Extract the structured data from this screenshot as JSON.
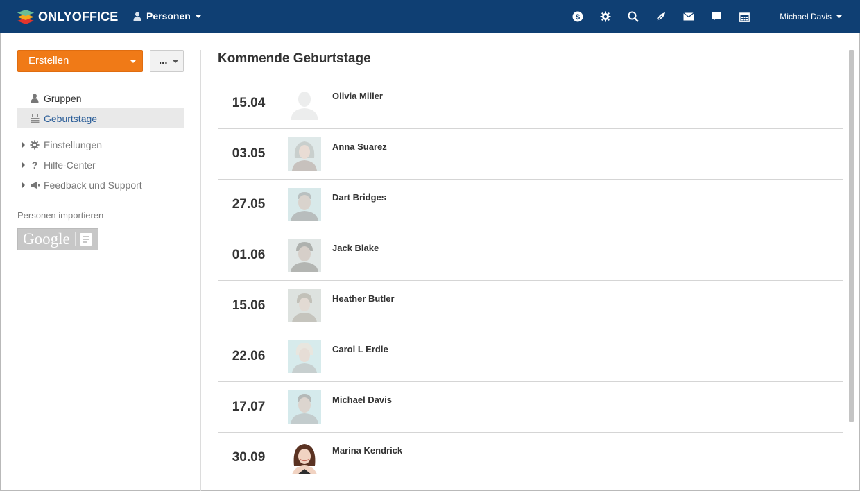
{
  "header": {
    "logo_text": "ONLYOFFICE",
    "module_label": "Personen",
    "icons": [
      "payment-icon",
      "settings-icon",
      "search-icon",
      "feed-icon",
      "mail-icon",
      "chat-icon",
      "calendar-icon"
    ],
    "user_name": "Michael Davis",
    "colors": {
      "bar": "#0f3f73"
    }
  },
  "sidebar": {
    "create_label": "Erstellen",
    "more_label": "...",
    "items": [
      {
        "label": "Gruppen",
        "icon": "user-icon",
        "active": false
      },
      {
        "label": "Geburtstage",
        "icon": "cake-icon",
        "active": true
      }
    ],
    "sub_items": [
      {
        "label": "Einstellungen",
        "icon": "gear-icon"
      },
      {
        "label": "Hilfe-Center",
        "icon": "question-icon"
      },
      {
        "label": "Feedback und Support",
        "icon": "megaphone-icon"
      }
    ],
    "import_label": "Personen importieren",
    "google_label": "Google",
    "colors": {
      "create": "#f07a17",
      "active_text": "#2a5d98"
    }
  },
  "main": {
    "title": "Kommende Geburtstage",
    "birthdays": [
      {
        "date": "15.04",
        "name": "Olivia Miller"
      },
      {
        "date": "03.05",
        "name": "Anna Suarez"
      },
      {
        "date": "27.05",
        "name": "Dart Bridges"
      },
      {
        "date": "01.06",
        "name": "Jack Blake"
      },
      {
        "date": "15.06",
        "name": "Heather Butler"
      },
      {
        "date": "22.06",
        "name": "Carol L Erdle"
      },
      {
        "date": "17.07",
        "name": "Michael Davis"
      },
      {
        "date": "30.09",
        "name": "Marina Kendrick"
      }
    ]
  }
}
